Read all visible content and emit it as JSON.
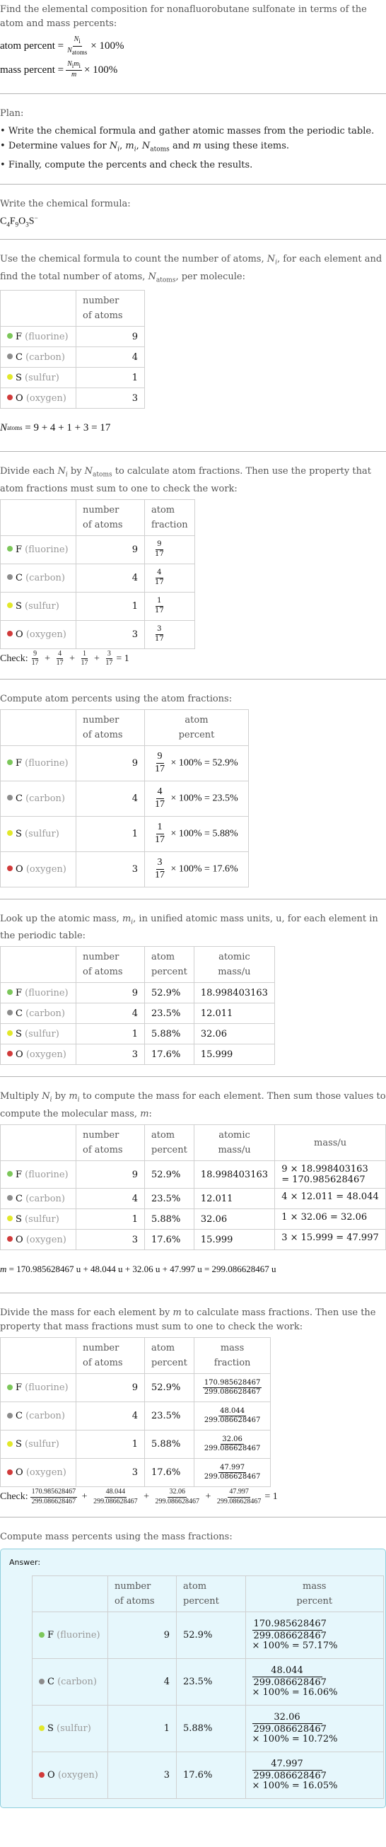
{
  "intro": {
    "question": "Find the elemental composition for nonafluorobutane sulfonate in terms of the atom and mass percents:",
    "atom_percent_label": "atom percent =",
    "mass_percent_label": "mass percent =",
    "times_100": "× 100%"
  },
  "plan": {
    "title": "Plan:",
    "items": [
      "Write the chemical formula and gather atomic masses from the periodic table.",
      "Determine values for N_i, m_i, N_atoms and m using these items.",
      "Finally, compute the percents and check the results."
    ]
  },
  "formula_step": {
    "intro": "Write the chemical formula:",
    "formula": "C4F9O3S−"
  },
  "elements": [
    {
      "symbol": "F",
      "name": "(fluorine)",
      "color": "#7cc75a",
      "count": "9",
      "atom_fraction_num": "9",
      "atom_fraction_den": "17",
      "atom_percent": "52.9%",
      "atomic_mass": "18.998403163",
      "mass_calc_a": "9 × 18.998403163",
      "mass_calc_b": "= 170.985628467",
      "mass": "170.985628467",
      "mass_percent": "57.17%"
    },
    {
      "symbol": "C",
      "name": "(carbon)",
      "color": "#8c8c8c",
      "count": "4",
      "atom_fraction_num": "4",
      "atom_fraction_den": "17",
      "atom_percent": "23.5%",
      "atomic_mass": "12.011",
      "mass_calc_a": "4 × 12.011 = 48.044",
      "mass_calc_b": "",
      "mass": "48.044",
      "mass_percent": "16.06%"
    },
    {
      "symbol": "S",
      "name": "(sulfur)",
      "color": "#e2e82a",
      "count": "1",
      "atom_fraction_num": "1",
      "atom_fraction_den": "17",
      "atom_percent": "5.88%",
      "atomic_mass": "32.06",
      "mass_calc_a": "1 × 32.06 = 32.06",
      "mass_calc_b": "",
      "mass": "32.06",
      "mass_percent": "10.72%"
    },
    {
      "symbol": "O",
      "name": "(oxygen)",
      "color": "#d13a3a",
      "count": "3",
      "atom_fraction_num": "3",
      "atom_fraction_den": "17",
      "atom_percent": "17.6%",
      "atomic_mass": "15.999",
      "mass_calc_a": "3 × 15.999 = 47.997",
      "mass_calc_b": "",
      "mass": "47.997",
      "mass_percent": "16.05%"
    }
  ],
  "headers": {
    "number_of_atoms": [
      "number",
      "of atoms"
    ],
    "atom_fraction": [
      "atom",
      "fraction"
    ],
    "atom_percent": [
      "atom",
      "percent"
    ],
    "atomic_mass": [
      "atomic",
      "mass/u"
    ],
    "mass": "mass/u",
    "mass_fraction": [
      "mass",
      "fraction"
    ],
    "mass_percent": [
      "mass",
      "percent"
    ]
  },
  "count_step": {
    "intro": "Use the chemical formula to count the number of atoms, N_i, for each element and find the total number of atoms, N_atoms, per molecule:",
    "total": "= 9 + 4 + 1 + 3 = 17"
  },
  "fraction_step": {
    "intro": "Divide each N_i by N_atoms to calculate atom fractions. Then use the property that atom fractions must sum to one to check the work:",
    "check_label": "Check:",
    "check_result": "= 1"
  },
  "atom_percent_step": {
    "intro": "Compute atom percents using the atom fractions:"
  },
  "mass_lookup_step": {
    "intro": "Look up the atomic mass, m_i, in unified atomic mass units, u, for each element in the periodic table:"
  },
  "mass_step": {
    "intro": "Multiply N_i by m_i to compute the mass for each element. Then sum those values to compute the molecular mass, m:",
    "total": "= 170.985628467 u + 48.044 u + 32.06 u + 47.997 u = 299.086628467 u",
    "molecular_mass": "299.086628467"
  },
  "mass_fraction_step": {
    "intro": "Divide the mass for each element by m to calculate mass fractions. Then use the property that mass fractions must sum to one to check the work:",
    "check_label": "Check:",
    "check_result": "= 1"
  },
  "mass_percent_step": {
    "intro": "Compute mass percents using the mass fractions:",
    "answer_label": "Answer:"
  }
}
